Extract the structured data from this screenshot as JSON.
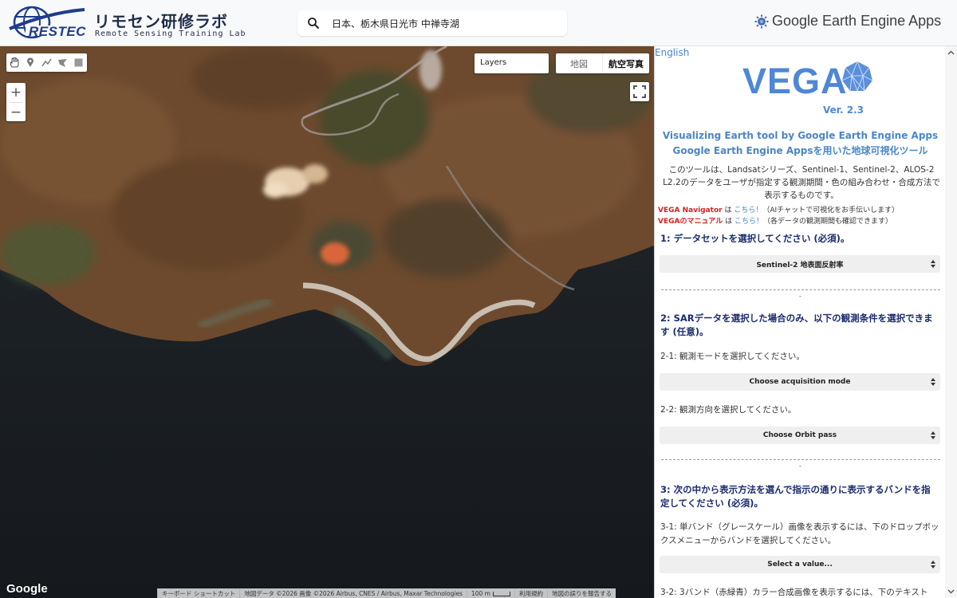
{
  "header": {
    "logo": {
      "mark_text": "RESTEC",
      "title": "リモセン研修ラボ",
      "subtitle": "Remote Sensing Training Lab"
    },
    "search": {
      "value": "日本、栃木県日光市 中禅寺湖"
    },
    "brand": {
      "text": "Google Earth Engine Apps"
    }
  },
  "map": {
    "layers_label": "Layers",
    "maptype": {
      "map": "地図",
      "satellite": "航空写真",
      "selected": "航空写真"
    },
    "zoom": {
      "in": "+",
      "out": "−"
    },
    "drawing_tools": [
      "hand-icon",
      "point-icon",
      "line-icon",
      "polygon-icon",
      "rectangle-icon"
    ],
    "google_logo": "Google",
    "attribution": {
      "shortcuts": "キーボード ショートカット",
      "data": "地図データ ©2026 画像 ©2026 Airbus, CNES / Airbus, Maxar Technologies",
      "scale": "100 m",
      "terms": "利用規約",
      "report": "地図の誤りを報告する"
    }
  },
  "panel": {
    "language_link": "English",
    "app_name": "VEGA",
    "version": "Ver. 2.3",
    "subtitle_en": "Visualizing Earth tool by Google Earth Engine Apps",
    "subtitle_ja": "Google Earth Engine Appsを用いた地球可視化ツール",
    "intro": "このツールは、Landsatシリーズ、Sentinel-1、Sentinel-2、ALOS-2 L2.2のデータをユーザが指定する観測期間・色の組み合わせ・合成方法で表示するものです。",
    "notes": [
      {
        "name": "VEGA Navigator",
        "connector": " は ",
        "link": "こちら！",
        "desc": "（AIチャットで可視化をお手伝いします）"
      },
      {
        "name": "VEGAのマニュアル",
        "connector": " は ",
        "link": "こちら！",
        "desc": "（各データの観測期間も確認できます）"
      }
    ],
    "step1": {
      "title": "1: データセットを選択してください (必須)。",
      "select": "Sentinel-2 地表面反射率"
    },
    "separator": "-",
    "step2": {
      "title": "2: SARデータを選択した場合のみ、以下の観測条件を選択できます (任意)。",
      "sub1": "2-1: 観測モードを選択してください。",
      "select1": "Choose acquisition mode",
      "sub2": "2-2: 観測方向を選択してください。",
      "select2": "Choose Orbit pass"
    },
    "step3": {
      "title": "3: 次の中から表示方法を選んで指示の通りに表示するバンドを指定してください (必須)。",
      "sub1": "3-1: 単バンド（グレースケール）画像を表示するには、下のドロップボックスメニューからバンドを選択してください。",
      "select1": "Select a value...",
      "sub2": "3-2: 3バンド（赤緑青）カラー合成画像を表示するには、下のテキスト"
    }
  }
}
